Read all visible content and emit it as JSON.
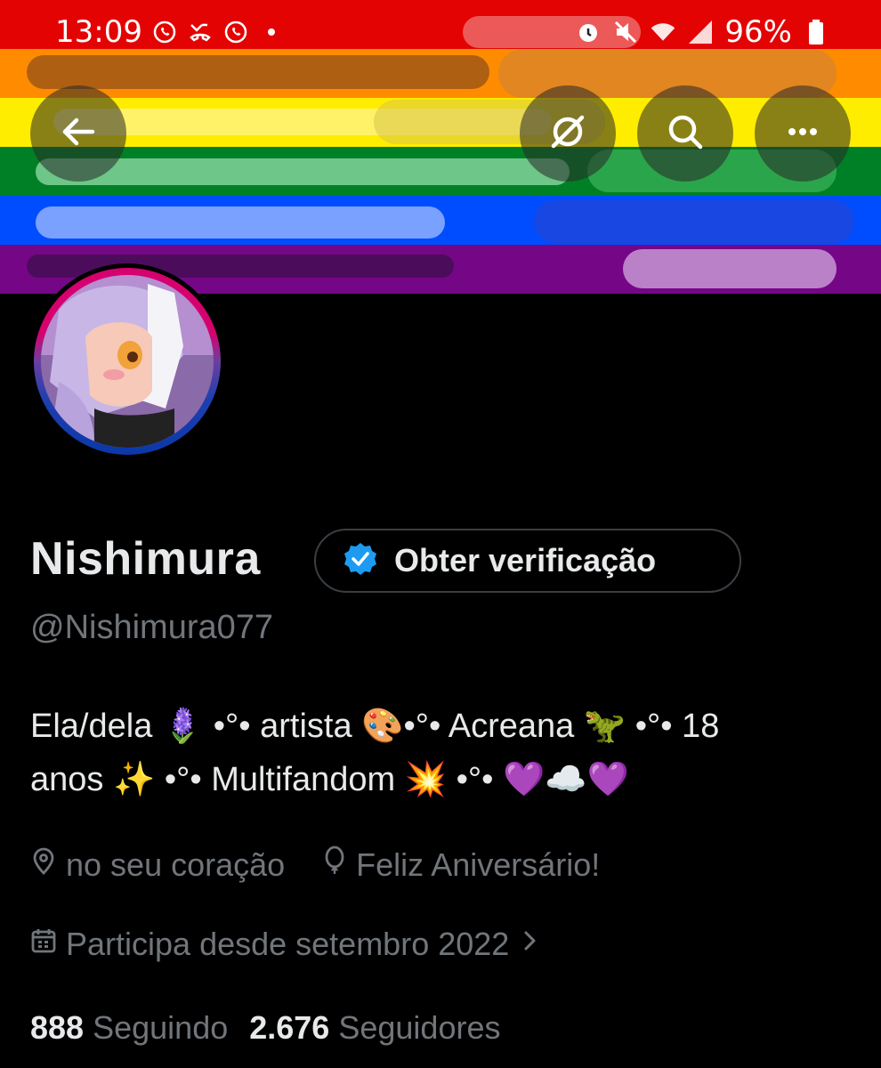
{
  "status_bar": {
    "time": "13:09",
    "battery": "96%",
    "left_icons": [
      "whatsapp-icon",
      "missed-call-icon",
      "whatsapp-icon",
      "dot-icon"
    ],
    "right_icons": [
      "alarm-icon",
      "mute-icon",
      "wifi-icon",
      "signal-icon",
      "battery-icon"
    ]
  },
  "banner": {
    "colors": [
      "#e40303",
      "#ff8c00",
      "#ffed00",
      "#008026",
      "#004dff",
      "#750787"
    ]
  },
  "toolbar": {
    "back_icon": "arrow-left-icon",
    "grok_icon": "grok-icon",
    "search_icon": "search-icon",
    "more_icon": "more-icon"
  },
  "profile": {
    "name": "Nishimura",
    "handle": "@Nishimura077",
    "verify_label": "Obter verificação",
    "bio_line1": "Ela/dela 🪻 •°• artista 🎨•°• Acreana 🦖 •°• 18",
    "bio_line2": "anos ✨ •°•  Multifandom 💥  •°• 💜☁️💜",
    "location": "no seu coração",
    "birthday": "Feliz Aniversário!",
    "joined": "Participa desde setembro 2022",
    "following_count": "888",
    "following_label": "Seguindo",
    "followers_count": "2.676",
    "followers_label": "Seguidores"
  },
  "colors": {
    "background": "#000000",
    "text": "#e7e9ea",
    "muted": "#71767b",
    "verify_blue": "#1d9bf0"
  }
}
